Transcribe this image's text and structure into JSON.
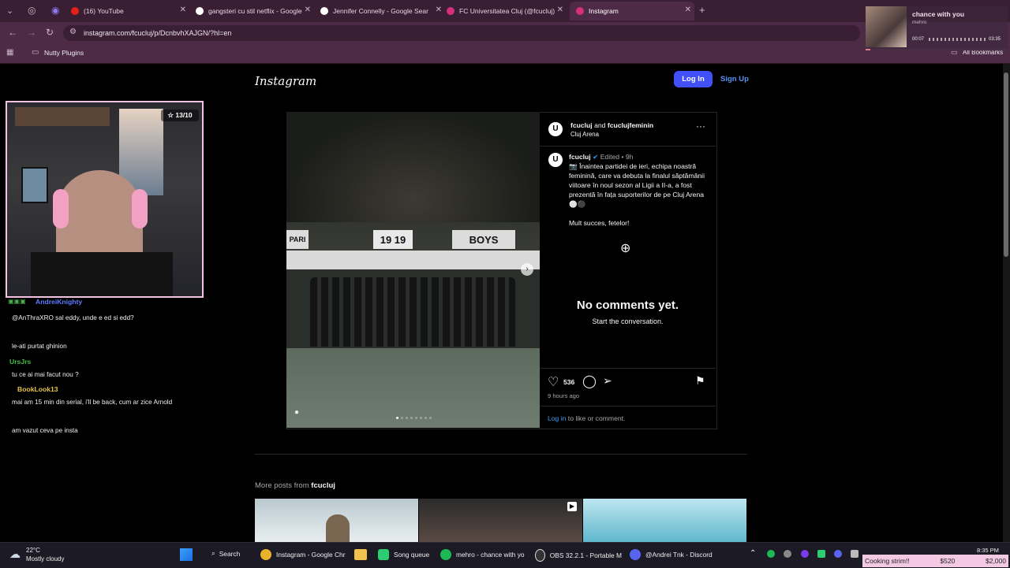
{
  "browser": {
    "tabs": [
      {
        "label": "(16) YouTube",
        "favicon": "youtube-icon"
      },
      {
        "label": "gangsteri cu stil netflix - Google",
        "favicon": "google-icon"
      },
      {
        "label": "Jennifer Connelly - Google Sear",
        "favicon": "google-icon"
      },
      {
        "label": "FC Universitatea Cluj (@fcucluj)",
        "favicon": "instagram-icon"
      },
      {
        "label": "Instagram",
        "favicon": "instagram-icon",
        "active": true
      }
    ],
    "url": "instagram.com/fcucluj/p/DcnbvhXAJGN/?hl=en",
    "bookmark_folder": "Nutty Plugins",
    "all_bookmarks": "All Bookmarks"
  },
  "music_overlay": {
    "title": "chance with you",
    "artist": "mehro",
    "elapsed": "00:07",
    "total": "03:35"
  },
  "instagram": {
    "logo": "Instagram",
    "login": "Log In",
    "signup": "Sign Up",
    "post": {
      "author": "fcucluj",
      "and": "and",
      "coauthor": "fcuclujfeminin",
      "location": "Cluj Arena",
      "banner_left": "PARI",
      "banner_mid": "19 19",
      "banner_right": "BOYS",
      "caption_author": "fcucluj",
      "edited": "Edited",
      "time": "9h",
      "caption": "📷 Înaintea partidei de ieri, echipa noastră feminină, care va debuta la finalul săptămânii viitoare în noul sezon al Ligii a II-a, a fost prezentă în fața suporterilor de pe Cluj Arena ⚪⚫",
      "caption_2": "Mult succes, fetelor!",
      "no_comments": "No comments yet.",
      "start_conversation": "Start the conversation.",
      "likes": "536",
      "posted": "9 hours ago",
      "login_link": "Log in",
      "login_suffix": " to like or comment."
    },
    "more_posts_prefix": "More posts from ",
    "more_posts_user": "fcucluj"
  },
  "stream_overlay": {
    "rating": "13/10",
    "chat": [
      {
        "user": "AndreiKnighty",
        "color": "#5b7cff"
      },
      {
        "text": "@AnThraXRO sal eddy, unde e ed si edd?"
      },
      {
        "text": "le-ati purtat ghinion"
      },
      {
        "user": "UrsJrs",
        "color": "#3fbf3f"
      },
      {
        "text": "tu ce ai mai facut nou ?"
      },
      {
        "user": "BookLook13",
        "color": "#e8c44a"
      },
      {
        "text": "mai am 15 min din serial, i'll be back, cum ar zice Arnold"
      },
      {
        "text": "am vazut ceva pe insta"
      }
    ]
  },
  "taskbar": {
    "weather_temp": "22°C",
    "weather_desc": "Mostly cloudy",
    "search": "Search",
    "items": [
      {
        "label": "Instagram - Google Chr"
      },
      {
        "label": "Song queue"
      },
      {
        "label": "mehro - chance with yo"
      },
      {
        "label": "OBS 32.2.1 - Portable M"
      },
      {
        "label": "@Andrei Tnk - Discord"
      }
    ],
    "alert": "Cooking strim!!",
    "donation": "$520",
    "goal": "$2,000",
    "time": "8:35 PM"
  }
}
